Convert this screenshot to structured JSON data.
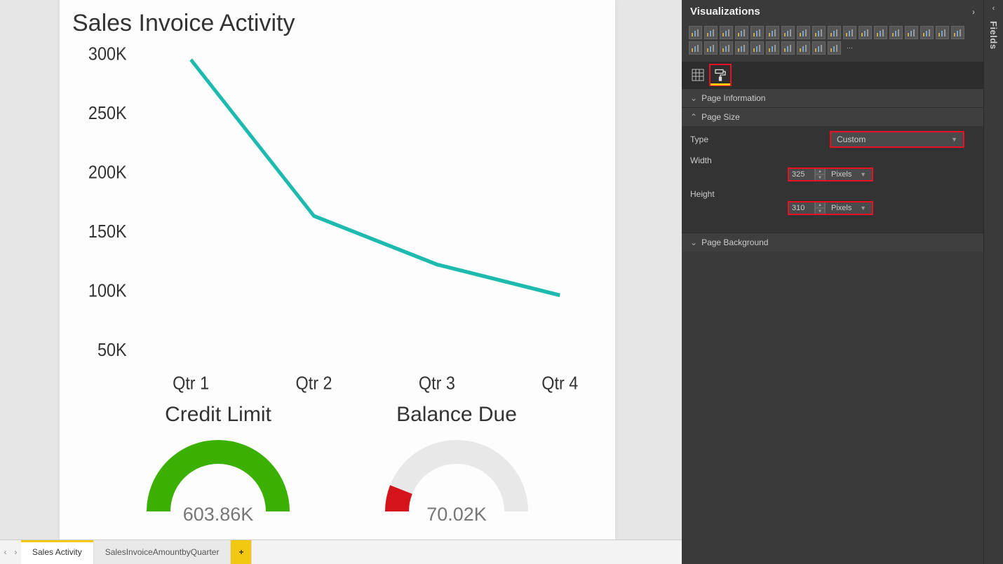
{
  "chart_data": {
    "type": "line",
    "title": "Sales Invoice Activity",
    "categories": [
      "Qtr 1",
      "Qtr 2",
      "Qtr 3",
      "Qtr 4"
    ],
    "values": [
      295000,
      163000,
      122000,
      96000
    ],
    "ylabel": "",
    "xlabel": "",
    "ylim": [
      50000,
      300000
    ],
    "yticks_labels": [
      "50K",
      "100K",
      "150K",
      "200K",
      "250K",
      "300K"
    ]
  },
  "kpis": [
    {
      "title": "Credit Limit",
      "value": "603.86K",
      "fill_ratio": 1.0,
      "color": "#3bb000",
      "track": "#e8e8e8"
    },
    {
      "title": "Balance Due",
      "value": "70.02K",
      "fill_ratio": 0.12,
      "color": "#d4141a",
      "track": "#e8e8e8"
    }
  ],
  "tabs": {
    "items": [
      "Sales Activity",
      "SalesInvoiceAmountbyQuarter"
    ],
    "active": 0,
    "add_symbol": "+"
  },
  "side": {
    "title": "Visualizations",
    "fields_rail": "Fields",
    "sections": {
      "page_info": "Page Information",
      "page_size": "Page Size",
      "page_bg": "Page Background"
    },
    "page_size": {
      "type_label": "Type",
      "type_value": "Custom",
      "width_label": "Width",
      "width_value": "325",
      "width_unit": "Pixels",
      "height_label": "Height",
      "height_value": "310",
      "height_unit": "Pixels"
    }
  }
}
